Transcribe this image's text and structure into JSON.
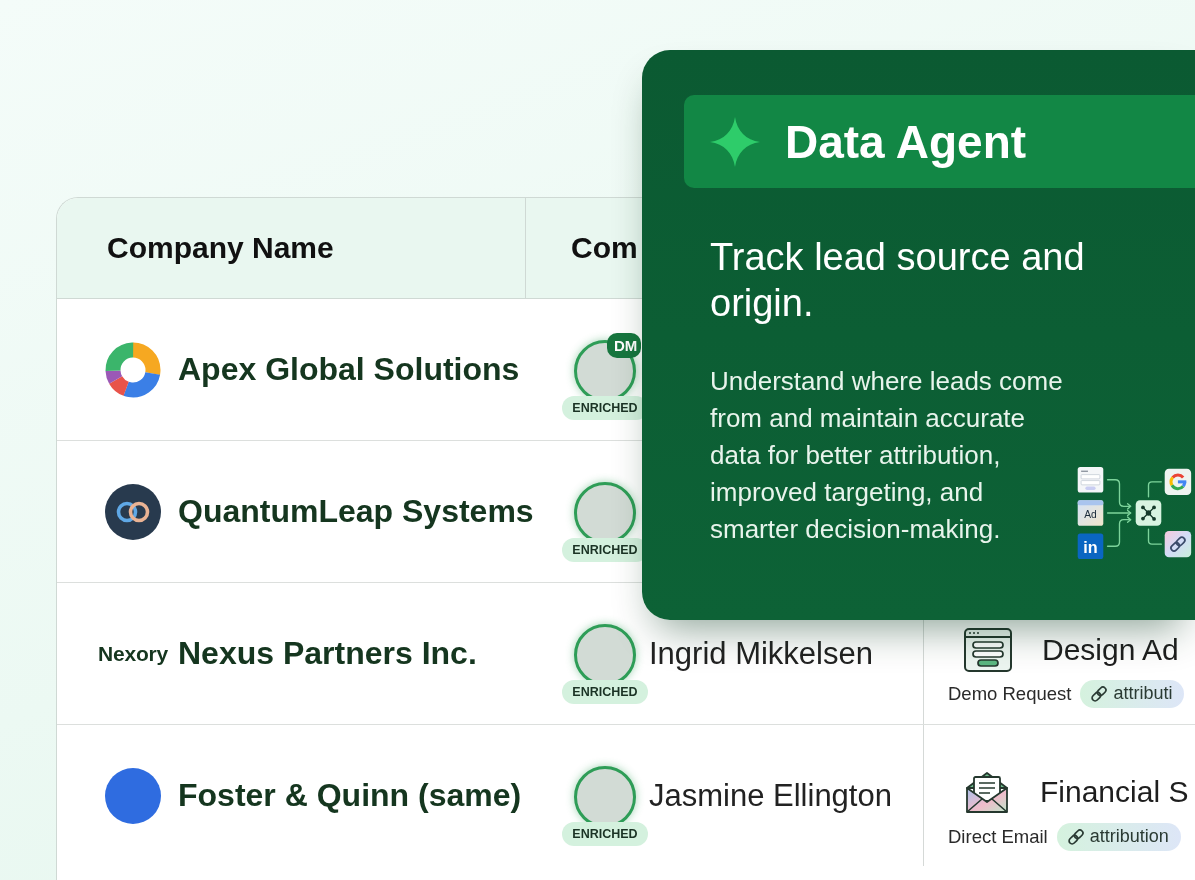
{
  "table": {
    "columns": [
      {
        "label": "Company Name"
      },
      {
        "label": "Com"
      }
    ],
    "rows": [
      {
        "company": {
          "logo": {
            "kind": "ring"
          },
          "name": "Apex Global Solutions"
        },
        "contact": {
          "badge": "DM",
          "status": "ENRICHED"
        }
      },
      {
        "company": {
          "logo": {
            "kind": "linked-rings"
          },
          "name": "QuantumLeap Systems"
        },
        "contact": {
          "status": "ENRICHED"
        }
      },
      {
        "company": {
          "logo": {
            "kind": "wordmark",
            "text": "Nexory"
          },
          "name": "Nexus Partners Inc."
        },
        "contact": {
          "name": "Ingrid Mikkelsen",
          "status": "ENRICHED"
        },
        "source": {
          "kind": "form",
          "title": "Design Ad",
          "channel": "Demo Request",
          "tag": "attributi"
        }
      },
      {
        "company": {
          "logo": {
            "kind": "dot"
          },
          "name": "Foster & Quinn (same)"
        },
        "contact": {
          "name": "Jasmine Ellington",
          "status": "ENRICHED"
        },
        "source": {
          "kind": "email",
          "title": "Financial S",
          "channel": "Direct Email",
          "tag": "attribution"
        }
      }
    ]
  },
  "agent_panel": {
    "title": "Data Agent",
    "heading": "Track lead source and origin.",
    "description": "Understand where leads come from and maintain accurate data for better attribution, improved targeting, and smarter decision-making.",
    "diagram": {
      "sources": [
        {
          "kind": "form"
        },
        {
          "kind": "ad",
          "label": "Ad"
        },
        {
          "kind": "social",
          "label": "in"
        }
      ],
      "targets": [
        {
          "kind": "g-logo"
        },
        {
          "kind": "link"
        }
      ]
    }
  }
}
